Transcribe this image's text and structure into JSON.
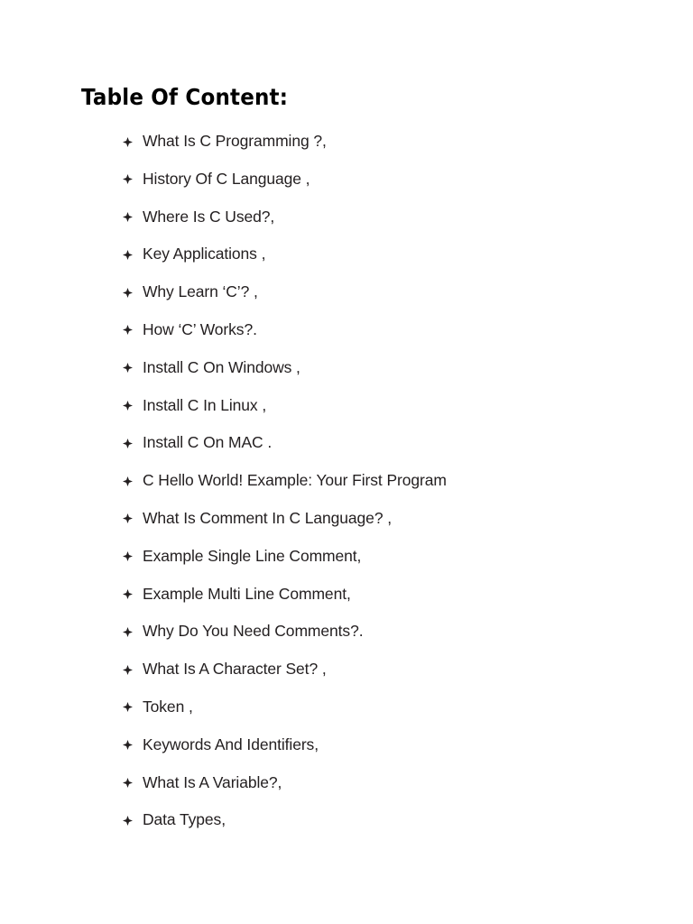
{
  "document": {
    "title": "Table Of Content:",
    "bullet_icon": "diamond-bullet-icon",
    "text_color": "#231f20",
    "title_color": "#000000",
    "background_color": "#ffffff",
    "items": [
      {
        "label": "What Is C Programming ?,"
      },
      {
        "label": "History Of C Language ,"
      },
      {
        "label": "Where Is C Used?,"
      },
      {
        "label": "Key Applications ,"
      },
      {
        "label": "Why Learn ‘C’? ,"
      },
      {
        "label": "How ‘C’ Works?."
      },
      {
        "label": "Install C On Windows ,"
      },
      {
        "label": "Install C In Linux ,"
      },
      {
        "label": "Install C On MAC ."
      },
      {
        "label": "C Hello World! Example: Your First Program"
      },
      {
        "label": "What Is Comment In C Language? ,"
      },
      {
        "label": "Example Single Line Comment,"
      },
      {
        "label": "Example Multi Line Comment,"
      },
      {
        "label": "Why Do You Need Comments?."
      },
      {
        "label": "What Is A Character Set? ,"
      },
      {
        "label": "Token ,"
      },
      {
        "label": "Keywords And Identifiers,"
      },
      {
        "label": "What Is A Variable?,"
      },
      {
        "label": "Data Types,"
      }
    ]
  }
}
